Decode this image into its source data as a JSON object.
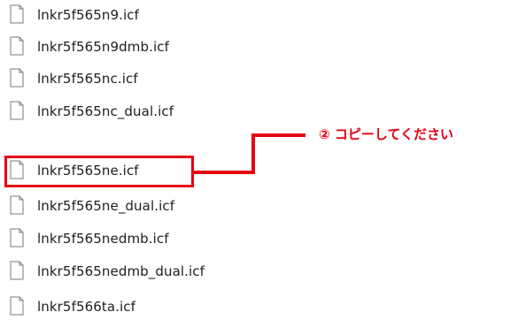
{
  "files": [
    {
      "name": "lnkr5f565n9.icf",
      "icon": "file-icon"
    },
    {
      "name": "lnkr5f565n9dmb.icf",
      "icon": "file-icon"
    },
    {
      "name": "lnkr5f565nc.icf",
      "icon": "file-icon"
    },
    {
      "name": "lnkr5f565nc_dual.icf",
      "icon": "file-icon"
    },
    {
      "name": "lnkr5f565ne.icf",
      "icon": "file-icon",
      "highlighted": true
    },
    {
      "name": "lnkr5f565ne_dual.icf",
      "icon": "file-icon"
    },
    {
      "name": "lnkr5f565nedmb.icf",
      "icon": "file-icon"
    },
    {
      "name": "lnkr5f565nedmb_dual.icf",
      "icon": "file-icon"
    },
    {
      "name": "lnkr5f566ta.icf",
      "icon": "file-icon"
    }
  ],
  "annotation": {
    "text": "② コピーしてください",
    "color": "#e60012"
  }
}
